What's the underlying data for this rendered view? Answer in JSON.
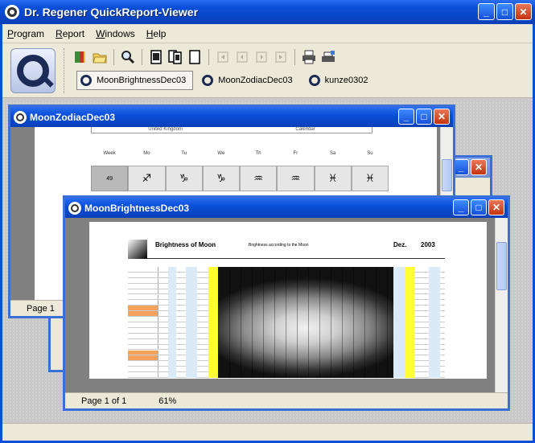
{
  "app": {
    "title": "Dr. Regener QuickReport-Viewer"
  },
  "menu": [
    {
      "key": "P",
      "rest": "rogram"
    },
    {
      "key": "R",
      "rest": "eport"
    },
    {
      "key": "W",
      "rest": "indows"
    },
    {
      "key": "H",
      "rest": "elp"
    }
  ],
  "toolbar": {
    "icons": [
      "book-icon",
      "open-folder-icon",
      "search-icon",
      "page-icon",
      "two-pages-icon",
      "blank-page-icon",
      "first-page-icon",
      "prev-page-icon",
      "next-page-icon",
      "last-page-icon",
      "print-icon",
      "printer-setup-icon"
    ]
  },
  "tabs": [
    {
      "label": "MoonBrightnessDec03",
      "active": true
    },
    {
      "label": "MoonZodiacDec03",
      "active": false
    },
    {
      "label": "kunze0302",
      "active": false
    }
  ],
  "windows": {
    "zodiac": {
      "title": "MoonZodiacDec03",
      "page_status": "Page 1",
      "header_left": "United Kingdom",
      "header_right": "Calendar",
      "days": [
        "Week",
        "Mo",
        "Tu",
        "We",
        "Th",
        "Fr",
        "Sa",
        "Su"
      ],
      "week_number": "49",
      "signs": [
        "♐",
        "♑",
        "♑",
        "♒",
        "♒",
        "♓",
        "♓"
      ]
    },
    "brightness": {
      "title": "MoonBrightnessDec03",
      "page_status": "Page 1 of 1",
      "zoom": "61%",
      "report_title": "Brightness of Moon",
      "report_month": "Dez.",
      "report_year": "2003",
      "report_desc": "Brightness according to the Moon"
    }
  },
  "colors": {
    "xp_blue": "#0a4fd8",
    "highlight_yellow": "#ffff33",
    "orange_cell": "#f5a25d"
  }
}
